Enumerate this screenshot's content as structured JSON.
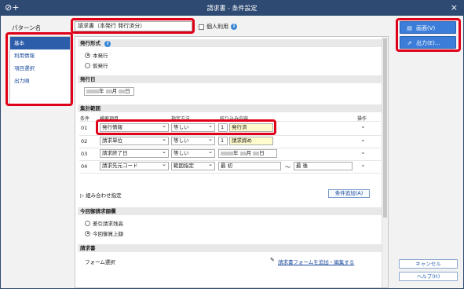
{
  "window": {
    "title": "請求書 - 条件設定",
    "app_icon": "⊘+",
    "close_label": "×"
  },
  "left": {
    "caption": "パターン名",
    "nav_items": [
      "基本",
      "利用情報",
      "項目選択",
      "出力順"
    ]
  },
  "header": {
    "pattern_name_value": "請求書（本発行 発行済分）",
    "personal_use_label": "個人利用",
    "info_glyph": "i"
  },
  "sections": {
    "issue_format": {
      "title": "発行形式",
      "options": [
        "本発行",
        "仮発行"
      ],
      "selected": "本発行"
    },
    "issue_date": {
      "title": "発行日",
      "year_label": "年",
      "month_label": "月",
      "day_label": "日"
    },
    "aggregation": {
      "title": "集計範囲",
      "headers": {
        "condition": "条件",
        "search_item": "検索項目",
        "method": "指定方法",
        "content": "絞り込み内容",
        "operation": "操作"
      },
      "rows": [
        {
          "num": "01",
          "item": "発行情報",
          "method": "等しい",
          "code": "1",
          "value": "発行済"
        },
        {
          "num": "02",
          "item": "請求単位",
          "method": "等しい",
          "code": "1",
          "value": "請求締め"
        },
        {
          "num": "03",
          "item": "請求終了日",
          "method": "等しい",
          "date_year": "年",
          "date_month": "月",
          "date_day": "日"
        },
        {
          "num": "04",
          "item": "請求先元コード",
          "method": "範囲指定",
          "from": "最 初",
          "tilde": "～",
          "to": "最 後"
        }
      ],
      "combine_label": "組み合わせ指定",
      "add_condition_label": "条件追加(A)"
    },
    "current_amount": {
      "title": "今回御請求額欄",
      "options": [
        "差引請求残高",
        "今回御買上額"
      ],
      "selected": "今回御買上額"
    },
    "invoice": {
      "title": "請求書",
      "form_select_label": "フォーム選択",
      "add_form_link": "請求書フォームを追加・編集する"
    }
  },
  "right": {
    "screen_button": "画面(V)",
    "output_button": "出力(E)...",
    "cancel_button": "キャンセル",
    "help_button": "ヘルプ(H)"
  },
  "colors": {
    "accent": "#3b7dd8",
    "highlight": "#e0001a",
    "titlebar": "#2e4a73"
  }
}
